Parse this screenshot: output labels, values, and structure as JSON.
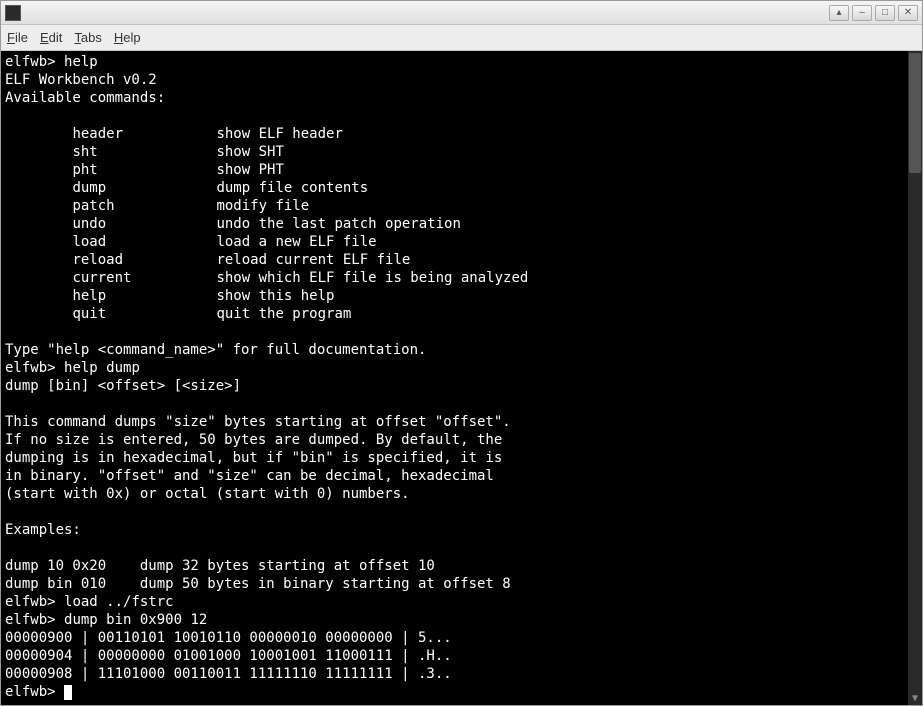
{
  "menubar": {
    "file": "File",
    "edit": "Edit",
    "tabs": "Tabs",
    "help": "Help"
  },
  "terminal": {
    "prompt": "elfwb> ",
    "cmd_help": "help",
    "version_line": "ELF Workbench v0.2",
    "avail_line": "Available commands:",
    "cmds": [
      {
        "name": "header",
        "desc": "show ELF header"
      },
      {
        "name": "sht",
        "desc": "show SHT"
      },
      {
        "name": "pht",
        "desc": "show PHT"
      },
      {
        "name": "dump",
        "desc": "dump file contents"
      },
      {
        "name": "patch",
        "desc": "modify file"
      },
      {
        "name": "undo",
        "desc": "undo the last patch operation"
      },
      {
        "name": "load",
        "desc": "load a new ELF file"
      },
      {
        "name": "reload",
        "desc": "reload current ELF file"
      },
      {
        "name": "current",
        "desc": "show which ELF file is being analyzed"
      },
      {
        "name": "help",
        "desc": "show this help"
      },
      {
        "name": "quit",
        "desc": "quit the program"
      }
    ],
    "full_doc_line": "Type \"help <command_name>\" for full documentation.",
    "cmd_help_dump": "help dump",
    "dump_usage": "dump [bin] <offset> [<size>]",
    "dump_desc_l1": "This command dumps \"size\" bytes starting at offset \"offset\".",
    "dump_desc_l2": "If no size is entered, 50 bytes are dumped. By default, the",
    "dump_desc_l3": "dumping is in hexadecimal, but if \"bin\" is specified, it is",
    "dump_desc_l4": "in binary. \"offset\" and \"size\" can be decimal, hexadecimal",
    "dump_desc_l5": "(start with 0x) or octal (start with 0) numbers.",
    "examples_hdr": "Examples:",
    "ex1": "dump 10 0x20    dump 32 bytes starting at offset 10",
    "ex2": "dump bin 010    dump 50 bytes in binary starting at offset 8",
    "cmd_load": "load ../fstrc",
    "cmd_dump_bin": "dump bin 0x900 12",
    "out1": "00000900 | 00110101 10010110 00000010 00000000 | 5...",
    "out2": "00000904 | 00000000 01001000 10001001 11000111 | .H..",
    "out3": "00000908 | 11101000 00110011 11111110 11111111 | .3.."
  }
}
